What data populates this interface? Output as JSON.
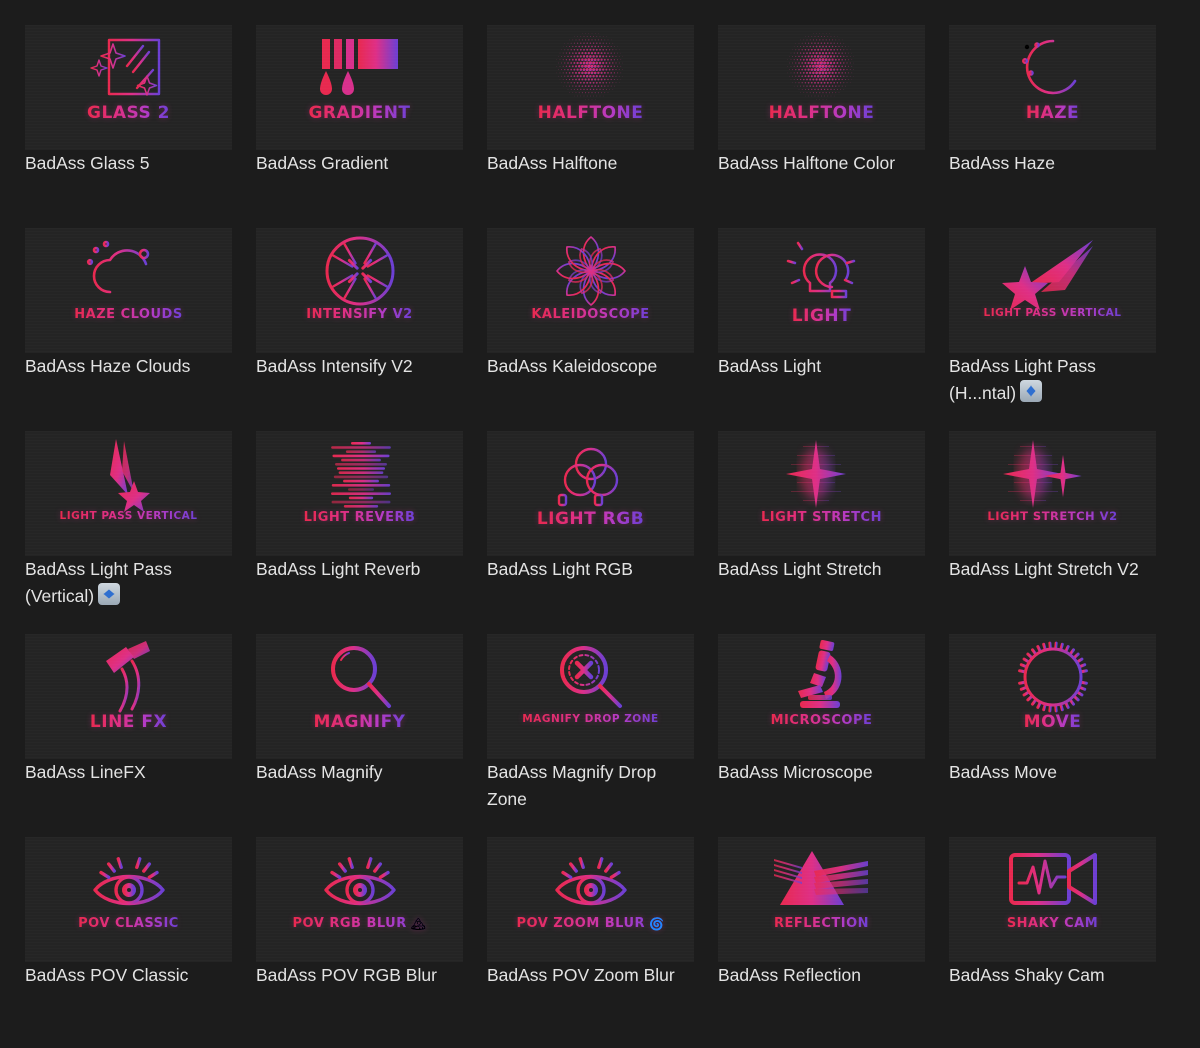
{
  "theme": {
    "page_background": "#1c1c1c",
    "thumb_background": "#242424",
    "caption_color": "#e3e3e3",
    "gradient_start": "#e8294f",
    "gradient_mid": "#de2f86",
    "gradient_end": "#6b3fd4",
    "badge_background": "#b9c4ce",
    "badge_glyph_color": "#2f6fd0"
  },
  "grid": {
    "columns": 5,
    "rows": 5,
    "items": [
      {
        "wordmark": "GLASS 2",
        "wordmark_size": "md",
        "caption": "BadAss Glass 5",
        "icon": "glass-sparkle-icon",
        "badge": null
      },
      {
        "wordmark": "GRADIENT",
        "wordmark_size": "md",
        "caption": "BadAss Gradient",
        "icon": "gradient-swatch-icon",
        "badge": null
      },
      {
        "wordmark": "HALFTONE",
        "wordmark_size": "md",
        "caption": "BadAss Halftone",
        "icon": "halftone-dots-icon",
        "badge": null
      },
      {
        "wordmark": "HALFTONE",
        "wordmark_size": "md",
        "caption": "BadAss Halftone Color",
        "icon": "halftone-dots-icon",
        "badge": null
      },
      {
        "wordmark": "HAZE",
        "wordmark_size": "md",
        "caption": "BadAss Haze",
        "icon": "haze-moon-icon",
        "badge": null
      },
      {
        "wordmark": "HAZE CLOUDS",
        "wordmark_size": "sm",
        "caption": "BadAss Haze Clouds",
        "icon": "haze-cloud-icon",
        "badge": null
      },
      {
        "wordmark": "INTENSIFY V2",
        "wordmark_size": "sm",
        "caption": "BadAss Intensify V2",
        "icon": "intensify-burst-icon",
        "badge": null
      },
      {
        "wordmark": "KALEIDOSCOPE",
        "wordmark_size": "sm",
        "caption": "BadAss Kaleidoscope",
        "icon": "kaleidoscope-flower-icon",
        "badge": null
      },
      {
        "wordmark": "LIGHT",
        "wordmark_size": "md",
        "caption": "BadAss Light",
        "icon": "light-bulb-icon",
        "badge": null
      },
      {
        "wordmark": "LIGHT PASS VERTICAL",
        "wordmark_size": "xxs",
        "caption": "BadAss Light Pass (H...ntal)",
        "icon": "light-pass-star-icon",
        "badge": "left-right-arrow-icon"
      },
      {
        "wordmark": "LIGHT PASS VERTICAL",
        "wordmark_size": "xxs",
        "caption": "BadAss Light Pass (Vertical)",
        "icon": "light-pass-vertical-icon",
        "badge": "up-down-arrow-icon"
      },
      {
        "wordmark": "LIGHT REVERB",
        "wordmark_size": "sm",
        "caption": "BadAss Light Reverb",
        "icon": "light-reverb-icon",
        "badge": null
      },
      {
        "wordmark": "LIGHT RGB",
        "wordmark_size": "md",
        "caption": "BadAss Light RGB",
        "icon": "light-rgb-circles-icon",
        "badge": null
      },
      {
        "wordmark": "LIGHT STRETCH",
        "wordmark_size": "sm",
        "caption": "BadAss Light Stretch",
        "icon": "light-stretch-icon",
        "badge": null
      },
      {
        "wordmark": "LIGHT STRETCH V2",
        "wordmark_size": "xs",
        "caption": "BadAss Light Stretch V2",
        "icon": "light-stretch-v2-icon",
        "badge": null
      },
      {
        "wordmark": "LINE FX",
        "wordmark_size": "md",
        "caption": "BadAss LineFX",
        "icon": "line-fx-brush-icon",
        "badge": null
      },
      {
        "wordmark": "MAGNIFY",
        "wordmark_size": "md",
        "caption": "BadAss Magnify",
        "icon": "magnify-glass-icon",
        "badge": null
      },
      {
        "wordmark": "MAGNIFY DROP ZONE",
        "wordmark_size": "xxs",
        "caption": "BadAss Magnify Drop Zone",
        "icon": "magnify-target-icon",
        "badge": null
      },
      {
        "wordmark": "MICROSCOPE",
        "wordmark_size": "sm",
        "caption": "BadAss Microscope",
        "icon": "microscope-icon",
        "badge": null
      },
      {
        "wordmark": "MOVE",
        "wordmark_size": "md",
        "caption": "BadAss Move",
        "icon": "move-gear-arrows-icon",
        "badge": null
      },
      {
        "wordmark": "POV CLASSIC",
        "wordmark_size": "sm",
        "caption": "BadAss POV Classic",
        "icon": "pov-eye-icon",
        "badge": null
      },
      {
        "wordmark": "POV RGB BLUR",
        "wordmark_size": "sm",
        "wordmark_glyph": "🏔",
        "caption": "BadAss POV RGB Blur",
        "icon": "pov-eye-icon",
        "badge": null
      },
      {
        "wordmark": "POV ZOOM BLUR",
        "wordmark_size": "sm",
        "wordmark_glyph": "🌀",
        "caption": "BadAss POV Zoom Blur",
        "icon": "pov-eye-icon",
        "badge": null
      },
      {
        "wordmark": "REFLECTION",
        "wordmark_size": "sm",
        "caption": "BadAss Reflection",
        "icon": "reflection-prism-icon",
        "badge": null
      },
      {
        "wordmark": "SHAKY CAM",
        "wordmark_size": "sm",
        "caption": "BadAss Shaky Cam",
        "icon": "shaky-cam-icon",
        "badge": null
      }
    ]
  }
}
